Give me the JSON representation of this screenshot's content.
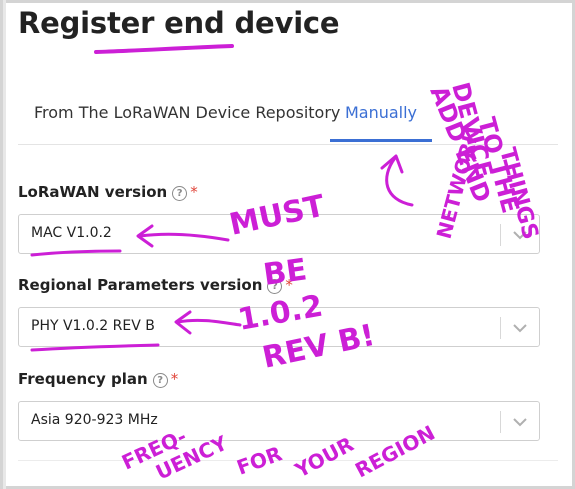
{
  "page": {
    "title": "Register end device"
  },
  "tabs": [
    {
      "label": "From The LoRaWAN Device Repository",
      "active": false
    },
    {
      "label": "Manually",
      "active": true
    }
  ],
  "form": {
    "lorawan_version": {
      "label": "LoRaWAN version",
      "value": "MAC V1.0.2",
      "required": true
    },
    "regional_parameters_version": {
      "label": "Regional Parameters version",
      "value": "PHY V1.0.2 REV B",
      "required": true
    },
    "frequency_plan": {
      "label": "Frequency plan",
      "value": "Asia 920-923 MHz",
      "required": true
    }
  },
  "symbols": {
    "help": "?",
    "required": "*"
  },
  "annotations": {
    "note_title_lines": [
      "ADD END",
      "DEVICE",
      "TO THE",
      "THINGS",
      "NETWORK"
    ],
    "note_version_lines": [
      "MUST",
      "BE",
      "1.0.2",
      "REV B!"
    ],
    "note_frequency_words": [
      "FREQ-",
      "UENCY",
      "FOR",
      "YOUR",
      "REGION"
    ],
    "ink_color": "#cc1fd6"
  },
  "colors": {
    "accent": "#3b6fd4",
    "required": "#e0453a",
    "text": "#222222"
  },
  "icons": {
    "help": "question-circle-icon",
    "dropdown": "chevron-down-icon"
  }
}
